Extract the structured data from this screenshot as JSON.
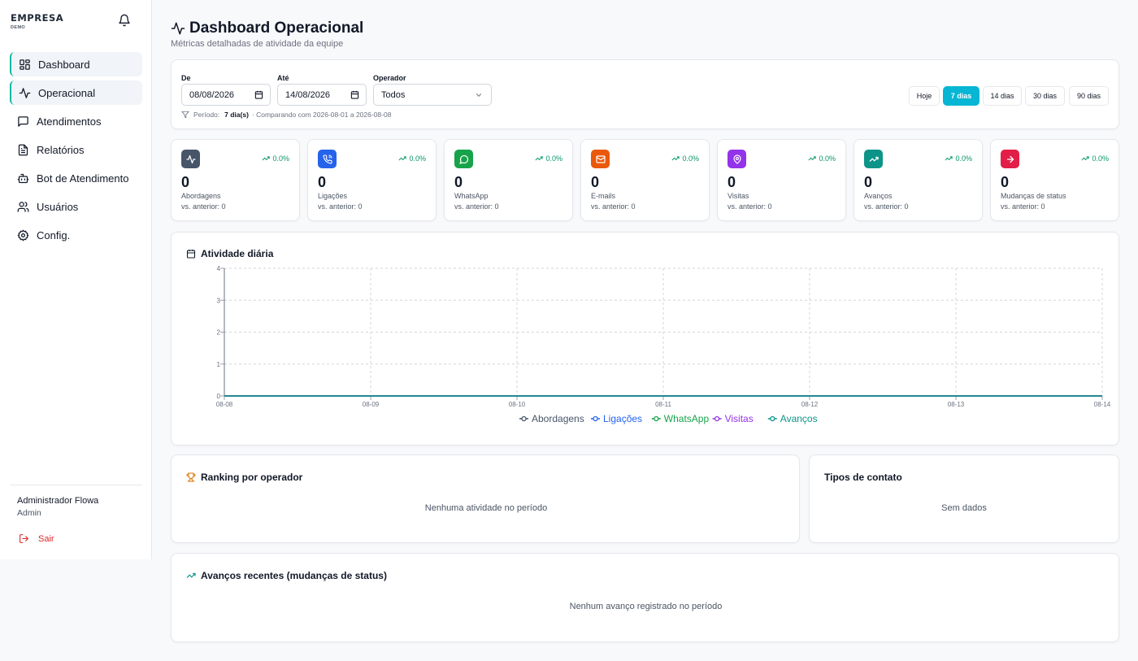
{
  "brand": {
    "name": "EMPRESA",
    "sub": "DEMO"
  },
  "sidebar": {
    "items": [
      {
        "label": "Dashboard",
        "icon": "grid-icon"
      },
      {
        "label": "Operacional",
        "icon": "activity-icon"
      },
      {
        "label": "Atendimentos",
        "icon": "message-square-icon"
      },
      {
        "label": "Relatórios",
        "icon": "file-text-icon"
      },
      {
        "label": "Bot de Atendimento",
        "icon": "bot-icon"
      },
      {
        "label": "Usuários",
        "icon": "users-icon"
      },
      {
        "label": "Config.",
        "icon": "gear-icon"
      }
    ],
    "user_name": "Administrador Flowa",
    "user_role": "Admin",
    "logout": "Sair"
  },
  "page": {
    "title": "Dashboard Operacional",
    "subtitle": "Métricas detalhadas de atividade da equipe"
  },
  "filters": {
    "from_label": "De",
    "from_value": "08/08/2026",
    "to_label": "Até",
    "to_value": "14/08/2026",
    "operator_label": "Operador",
    "operator_value": "Todos",
    "period_label": "Período:",
    "period_value": "7 dia(s)",
    "compare_text": "· Comparando com 2026-08-01 a 2026-08-08",
    "ranges": [
      "Hoje",
      "7 dias",
      "14 dias",
      "30 dias",
      "90 dias"
    ],
    "active_range": "7 dias"
  },
  "stats": [
    {
      "label": "Abordagens",
      "value": "0",
      "trend": "0.0%",
      "prev": "vs. anterior: 0",
      "color": "#475569",
      "icon": "activity-icon"
    },
    {
      "label": "Ligações",
      "value": "0",
      "trend": "0.0%",
      "prev": "vs. anterior: 0",
      "color": "#2563eb",
      "icon": "phone-icon"
    },
    {
      "label": "WhatsApp",
      "value": "0",
      "trend": "0.0%",
      "prev": "vs. anterior: 0",
      "color": "#16a34a",
      "icon": "chat-bubble-icon"
    },
    {
      "label": "E-mails",
      "value": "0",
      "trend": "0.0%",
      "prev": "vs. anterior: 0",
      "color": "#ea580c",
      "icon": "mail-icon"
    },
    {
      "label": "Visitas",
      "value": "0",
      "trend": "0.0%",
      "prev": "vs. anterior: 0",
      "color": "#9333ea",
      "icon": "map-pin-icon"
    },
    {
      "label": "Avanços",
      "value": "0",
      "trend": "0.0%",
      "prev": "vs. anterior: 0",
      "color": "#0d9488",
      "icon": "trending-up-icon"
    },
    {
      "label": "Mudanças de status",
      "value": "0",
      "trend": "0.0%",
      "prev": "vs. anterior: 0",
      "color": "#e11d48",
      "icon": "arrow-right-icon"
    }
  ],
  "chart_data": {
    "type": "line",
    "title": "Atividade diária",
    "x": [
      "08-08",
      "08-09",
      "08-10",
      "08-11",
      "08-12",
      "08-13",
      "08-14"
    ],
    "ylim": [
      0,
      4
    ],
    "yticks": [
      0,
      1,
      2,
      3,
      4
    ],
    "grid": true,
    "legend": "bottom",
    "series": [
      {
        "name": "Abordagens",
        "color": "#475569",
        "values": [
          0,
          0,
          0,
          0,
          0,
          0,
          0
        ]
      },
      {
        "name": "Ligações",
        "color": "#2563eb",
        "values": [
          0,
          0,
          0,
          0,
          0,
          0,
          0
        ]
      },
      {
        "name": "WhatsApp",
        "color": "#16a34a",
        "values": [
          0,
          0,
          0,
          0,
          0,
          0,
          0
        ]
      },
      {
        "name": "Visitas",
        "color": "#9333ea",
        "values": [
          0,
          0,
          0,
          0,
          0,
          0,
          0
        ]
      },
      {
        "name": "Avanços",
        "color": "#0d9488",
        "values": [
          0,
          0,
          0,
          0,
          0,
          0,
          0
        ]
      }
    ]
  },
  "ranking": {
    "title": "Ranking por operador",
    "empty": "Nenhuma atividade no período"
  },
  "contact_types": {
    "title": "Tipos de contato",
    "empty": "Sem dados"
  },
  "recent": {
    "title": "Avanços recentes (mudanças de status)",
    "empty": "Nenhum avanço registrado no período"
  }
}
